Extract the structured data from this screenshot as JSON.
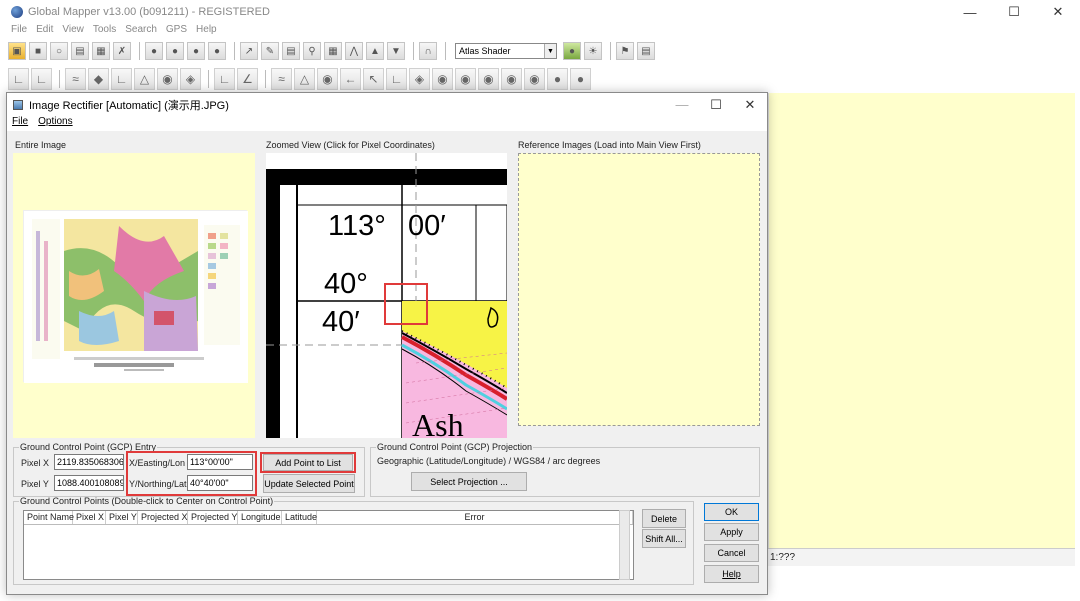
{
  "main_window": {
    "title": "Global Mapper v13.00 (b091211) - REGISTERED",
    "menu": [
      "File",
      "Edit",
      "View",
      "Tools",
      "Search",
      "GPS",
      "Help"
    ],
    "shader_select": "Atlas Shader",
    "status_fragment": "1:???"
  },
  "dialog": {
    "title": "Image Rectifier [Automatic] (演示用.JPG)",
    "menu": {
      "file": "File",
      "options": "Options"
    },
    "entire_image_label": "Entire Image",
    "zoomed_view_label": "Zoomed View (Click for Pixel Coordinates)",
    "reference_images_label": "Reference Images (Load into Main View First)",
    "zoom_texts": {
      "lon_deg": "113°",
      "lon_min": "00′",
      "lat_deg": "40°",
      "lat_min": "40′",
      "unit_label": "Ash"
    },
    "gcp_entry": {
      "legend": "Ground Control Point (GCP) Entry",
      "pixel_x_label": "Pixel X",
      "pixel_x_value": "2119.835068306",
      "pixel_y_label": "Pixel Y",
      "pixel_y_value": "1088.400108089",
      "x_label": "X/Easting/Lon",
      "x_value": "113°00'00\"",
      "y_label": "Y/Northing/Lat",
      "y_value": "40°40'00\"",
      "add_point_button": "Add Point to List",
      "update_point_button": "Update Selected Point"
    },
    "gcp_projection": {
      "legend": "Ground Control Point (GCP) Projection",
      "text": "Geographic (Latitude/Longitude) / WGS84 / arc degrees",
      "select_button": "Select Projection ..."
    },
    "gcp_list": {
      "legend": "Ground Control Points (Double-click to Center on Control Point)",
      "columns": [
        "Point Name",
        "Pixel X",
        "Pixel Y",
        "Projected X",
        "Projected Y",
        "Longitude",
        "Latitude",
        "Error"
      ],
      "delete_button": "Delete",
      "shift_all_button": "Shift All..."
    },
    "buttons": {
      "ok": "OK",
      "apply": "Apply",
      "cancel": "Cancel",
      "help": "Help"
    }
  },
  "icons": {
    "minimize": "minimize-icon",
    "maximize": "maximize-icon",
    "close": "close-icon"
  },
  "colors": {
    "map_background": "#ffffcc",
    "highlight_red": "#e03a3a"
  }
}
